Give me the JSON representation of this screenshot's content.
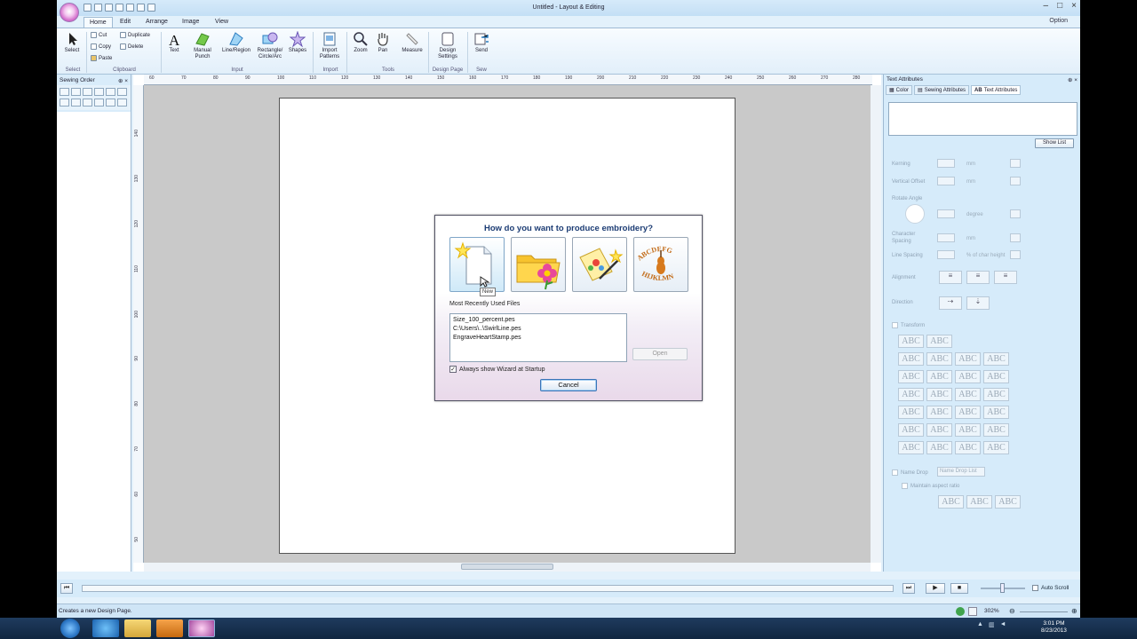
{
  "window": {
    "title": "Untitled - Layout & Editing",
    "option_label": "Option"
  },
  "tabs": [
    "Home",
    "Edit",
    "Arrange",
    "Image",
    "View"
  ],
  "ribbon": {
    "select": "Select",
    "cut": "Cut",
    "copy": "Copy",
    "paste": "Paste",
    "duplicate": "Duplicate",
    "delete": "Delete",
    "text": "Text",
    "manual_punch": "Manual Punch",
    "line_region": "Line/Region",
    "rect_circle": "Rectangle/ Circle/Arc",
    "shapes": "Shapes",
    "import_patterns": "Import Patterns",
    "zoom": "Zoom",
    "pan": "Pan",
    "measure": "Measure",
    "design_settings": "Design Settings",
    "send": "Send",
    "groups": {
      "select": "Select",
      "clipboard": "Clipboard",
      "input": "Input",
      "import": "Import",
      "tools": "Tools",
      "design_page": "Design Page",
      "sew": "Sew"
    }
  },
  "left_panel": {
    "title": "Sewing Order"
  },
  "ruler_h": [
    "60",
    "70",
    "80",
    "90",
    "100",
    "110",
    "120",
    "130",
    "140",
    "150",
    "160",
    "170",
    "180",
    "190",
    "200",
    "210",
    "220",
    "230",
    "240",
    "250",
    "260",
    "270",
    "280"
  ],
  "ruler_v": [
    "140",
    "130",
    "120",
    "110",
    "100",
    "90",
    "80",
    "70",
    "60",
    "50",
    "40"
  ],
  "right_panel": {
    "title": "Text Attributes",
    "tabs": [
      "Color",
      "Sewing Attributes",
      "Text Attributes"
    ],
    "show_list": "Show List",
    "kerning": "Kerning",
    "vertical_offset": "Vertical Offset",
    "rotate_angle": "Rotate Angle",
    "char_spacing": "Character Spacing",
    "line_spacing": "Line Spacing",
    "alignment": "Alignment",
    "direction": "Direction",
    "unit_mm": "mm",
    "unit_degree": "degree",
    "unit_char_height": "% of char height",
    "transform": "Transform",
    "name_drop": "Name Drop",
    "name_drop_list": "Name Drop List",
    "maintain_aspect": "Maintain aspect ratio",
    "abc": "ABC"
  },
  "dialog": {
    "title": "How do you want to produce embroidery?",
    "tooltip": "New",
    "mru_label": "Most Recently Used Files",
    "mru_files": [
      "Size_100_percent.pes",
      "C:\\Users\\..\\SwirlLine.pes",
      "EngraveHeartStamp.pes"
    ],
    "open": "Open",
    "always_show": "Always show Wizard at Startup",
    "cancel": "Cancel",
    "font_sample_top": "ABCDEFG",
    "font_sample_bottom": "HIJKLMN"
  },
  "bottom": {
    "auto_scroll": "Auto Scroll"
  },
  "status": {
    "text": "Creates a new Design Page.",
    "zoom": "302%"
  },
  "taskbar": {
    "time": "3:01 PM",
    "date": "8/23/2013"
  }
}
